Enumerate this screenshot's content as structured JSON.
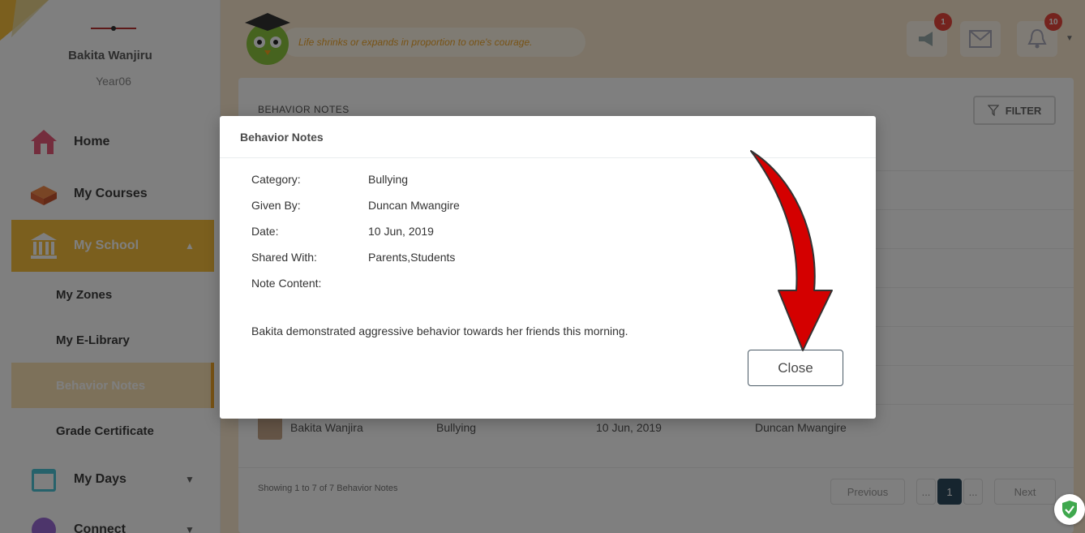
{
  "sidebar": {
    "user_name": "Bakita Wanjiru",
    "user_year": "Year06",
    "nav": {
      "home": "Home",
      "courses": "My Courses",
      "school": "My School",
      "days": "My Days",
      "connect": "Connect"
    },
    "sub": {
      "zones": "My Zones",
      "elibrary": "My E-Library",
      "behavior": "Behavior Notes",
      "grade": "Grade Certificate"
    }
  },
  "header": {
    "quote": "Life shrinks or expands in proportion to one's courage.",
    "announcements_badge": "1",
    "notifications_badge": "10",
    "icons": [
      "megaphone-icon",
      "mail-icon",
      "bell-icon"
    ]
  },
  "main": {
    "card_title": "BEHAVIOR NOTES",
    "filter_label": "FILTER",
    "row": {
      "student": "Bakita Wanjira",
      "category": "Bullying",
      "date": "10 Jun, 2019",
      "given_by": "Duncan Mwangire"
    },
    "showing": "Showing 1 to 7 of 7 Behavior Notes",
    "pagination": {
      "previous": "Previous",
      "ellipsis_left": "...",
      "current": "1",
      "ellipsis_right": "...",
      "next": "Next"
    }
  },
  "modal": {
    "title": "Behavior Notes",
    "fields": [
      {
        "label": "Category:",
        "value": "Bullying"
      },
      {
        "label": "Given By:",
        "value": "Duncan Mwangire"
      },
      {
        "label": "Date:",
        "value": "10 Jun, 2019"
      },
      {
        "label": "Shared With:",
        "value": "Parents,Students"
      },
      {
        "label": "Note Content:",
        "value": ""
      }
    ],
    "note": "Bakita demonstrated aggressive behavior towards her friends this morning.",
    "close_label": "Close"
  },
  "colors": {
    "accent": "#f6bf3c",
    "annotation_arrow": "#d40000",
    "badge": "#e9463c"
  }
}
